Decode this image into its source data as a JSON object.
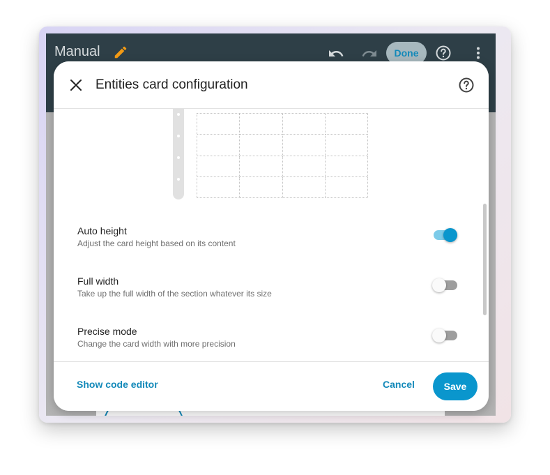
{
  "app": {
    "title": "Manual",
    "done_label": "Done"
  },
  "dialog": {
    "title": "Entities card configuration",
    "options": [
      {
        "label": "Auto height",
        "description": "Adjust the card height based on its content",
        "enabled": true
      },
      {
        "label": "Full width",
        "description": "Take up the full width of the section whatever its size",
        "enabled": false
      },
      {
        "label": "Precise mode",
        "description": "Change the card width with more precision",
        "enabled": false
      }
    ],
    "footer": {
      "code_editor_label": "Show code editor",
      "cancel_label": "Cancel",
      "save_label": "Save"
    }
  },
  "icons": {
    "edit": "pencil-icon",
    "undo": "undo-icon",
    "redo": "redo-icon",
    "help": "help-circle-icon",
    "more": "more-vertical-icon",
    "close": "close-icon"
  },
  "colors": {
    "header_bg": "#2e3f47",
    "accent": "#0a96cd",
    "accent_text": "#1389b9",
    "pencil": "#f29a14",
    "toggle_on_track": "#7ccbe9",
    "toggle_off_track": "#9e9e9e"
  }
}
